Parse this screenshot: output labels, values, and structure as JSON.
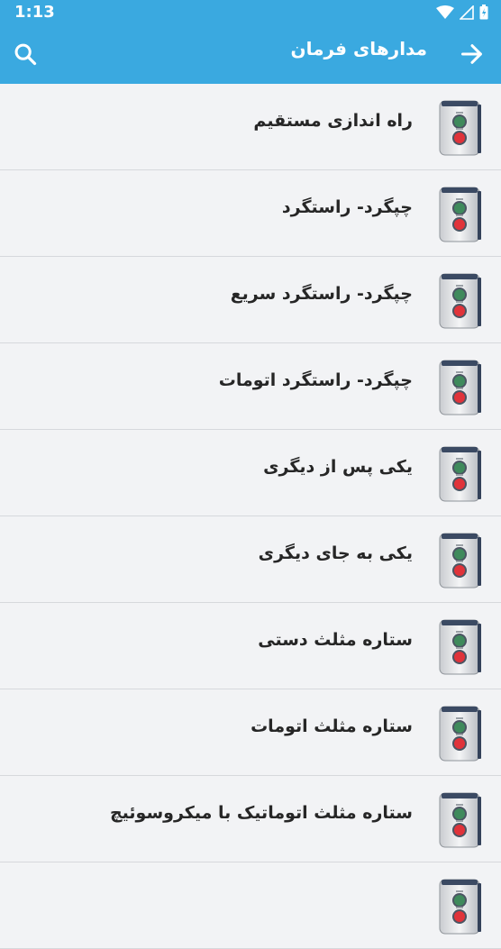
{
  "status_bar": {
    "time": "1:13"
  },
  "app_bar": {
    "title": "مدارهای فرمان"
  },
  "items": [
    {
      "label": "راه اندازی مستقیم"
    },
    {
      "label": "چپگرد- راستگرد"
    },
    {
      "label": "چپگرد- راستگرد سریع"
    },
    {
      "label": "چپگرد- راستگرد اتومات"
    },
    {
      "label": "یکی پس از دیگری"
    },
    {
      "label": "یکی به جای دیگری"
    },
    {
      "label": "ستاره مثلث دستی"
    },
    {
      "label": "ستاره مثلث اتومات"
    },
    {
      "label": "ستاره مثلث اتوماتیک با میکروسوئیچ"
    },
    {
      "label": ""
    }
  ],
  "colors": {
    "primary": "#3aa9e0",
    "background": "#f2f3f5",
    "divider": "#d6d8dc"
  }
}
